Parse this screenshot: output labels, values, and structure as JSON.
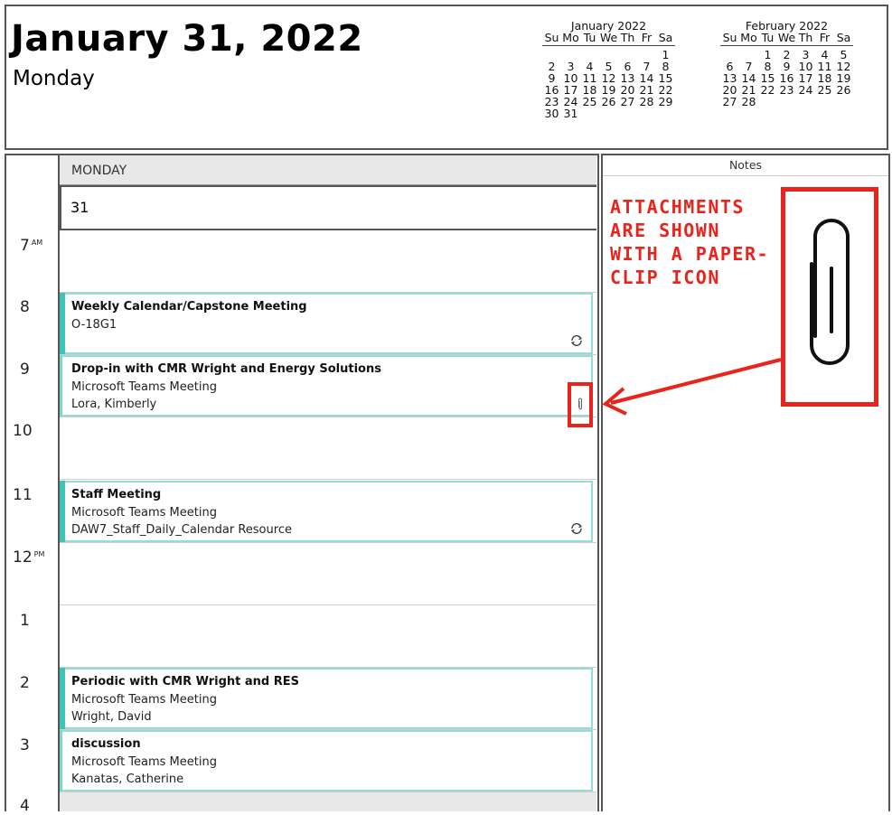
{
  "header": {
    "date_title": "January 31, 2022",
    "weekday": "Monday"
  },
  "mini_calendars": [
    {
      "title": "January 2022",
      "day_headers": [
        "Su",
        "Mo",
        "Tu",
        "We",
        "Th",
        "Fr",
        "Sa"
      ],
      "weeks": [
        [
          "",
          "",
          "",
          "",
          "",
          "",
          "1"
        ],
        [
          "2",
          "3",
          "4",
          "5",
          "6",
          "7",
          "8"
        ],
        [
          "9",
          "10",
          "11",
          "12",
          "13",
          "14",
          "15"
        ],
        [
          "16",
          "17",
          "18",
          "19",
          "20",
          "21",
          "22"
        ],
        [
          "23",
          "24",
          "25",
          "26",
          "27",
          "28",
          "29"
        ],
        [
          "30",
          "31",
          "",
          "",
          "",
          "",
          ""
        ]
      ]
    },
    {
      "title": "February 2022",
      "day_headers": [
        "Su",
        "Mo",
        "Tu",
        "We",
        "Th",
        "Fr",
        "Sa"
      ],
      "weeks": [
        [
          "",
          "",
          "1",
          "2",
          "3",
          "4",
          "5"
        ],
        [
          "6",
          "7",
          "8",
          "9",
          "10",
          "11",
          "12"
        ],
        [
          "13",
          "14",
          "15",
          "16",
          "17",
          "18",
          "19"
        ],
        [
          "20",
          "21",
          "22",
          "23",
          "24",
          "25",
          "26"
        ],
        [
          "27",
          "28",
          "",
          "",
          "",
          "",
          ""
        ]
      ]
    }
  ],
  "day_view": {
    "column_header": "MONDAY",
    "date_number": "31",
    "hours": [
      {
        "label": "7",
        "suffix": "AM"
      },
      {
        "label": "8",
        "suffix": ""
      },
      {
        "label": "9",
        "suffix": ""
      },
      {
        "label": "10",
        "suffix": ""
      },
      {
        "label": "11",
        "suffix": ""
      },
      {
        "label": "12",
        "suffix": "PM"
      },
      {
        "label": "1",
        "suffix": ""
      },
      {
        "label": "2",
        "suffix": ""
      },
      {
        "label": "3",
        "suffix": ""
      },
      {
        "label": "4",
        "suffix": ""
      }
    ],
    "events": [
      {
        "title": "Weekly Calendar/Capstone Meeting",
        "line2": "O-18G1",
        "line3": "",
        "icon": "recurrence-icon"
      },
      {
        "title": "Drop-in with CMR Wright and Energy Solutions",
        "line2": "Microsoft Teams Meeting",
        "line3": "Lora, Kimberly",
        "icon": "paperclip-icon"
      },
      {
        "title": "Staff Meeting",
        "line2": "Microsoft Teams Meeting",
        "line3": "DAW7_Staff_Daily_Calendar Resource",
        "icon": "recurrence-icon"
      },
      {
        "title": "Periodic with CMR Wright and RES",
        "line2": "Microsoft Teams Meeting",
        "line3": "Wright, David",
        "icon": ""
      },
      {
        "title": "discussion",
        "line2": "Microsoft Teams Meeting",
        "line3": "Kanatas, Catherine",
        "icon": ""
      }
    ]
  },
  "notes": {
    "header": "Notes"
  },
  "annotation": {
    "lines": [
      "ATTACHMENTS",
      "ARE SHOWN",
      "WITH A PAPER-",
      "CLIP ICON"
    ],
    "color": "#e8241c"
  },
  "colors": {
    "event_border": "#95ddd4",
    "event_bar": "#3ec4b4"
  }
}
